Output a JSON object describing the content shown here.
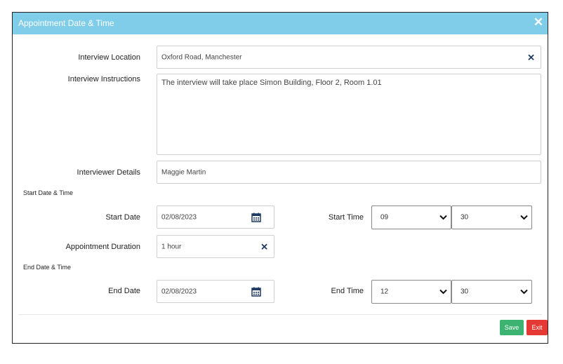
{
  "dialog": {
    "title": "Appointment Date & Time"
  },
  "form": {
    "interview_location_label": "Interview Location",
    "interview_location_value": "Oxford Road, Manchester",
    "interview_instructions_label": "Interview Instructions",
    "interview_instructions_value": "The interview will take place Simon Building, Floor 2, Room 1.01",
    "interviewer_details_label": "Interviewer Details",
    "interviewer_details_value": "Maggie Martin",
    "start_section_label": "Start Date & Time",
    "start_date_label": "Start Date",
    "start_date_value": "02/08/2023",
    "start_time_label": "Start Time",
    "start_hour": "09",
    "start_minute": "30",
    "duration_label": "Appointment Duration",
    "duration_value": "1 hour",
    "end_section_label": "End Date & Time",
    "end_date_label": "End Date",
    "end_date_value": "02/08/2023",
    "end_time_label": "End Time",
    "end_hour": "12",
    "end_minute": "30"
  },
  "buttons": {
    "save": "Save",
    "exit": "Exit"
  },
  "icons": {
    "close": "close-icon",
    "clear": "clear-icon",
    "calendar": "calendar-icon",
    "chevron": "chevron-down-icon"
  },
  "colors": {
    "header": "#7fcde8",
    "save": "#3cb371",
    "exit": "#e53935",
    "icon": "#1f3a63"
  }
}
